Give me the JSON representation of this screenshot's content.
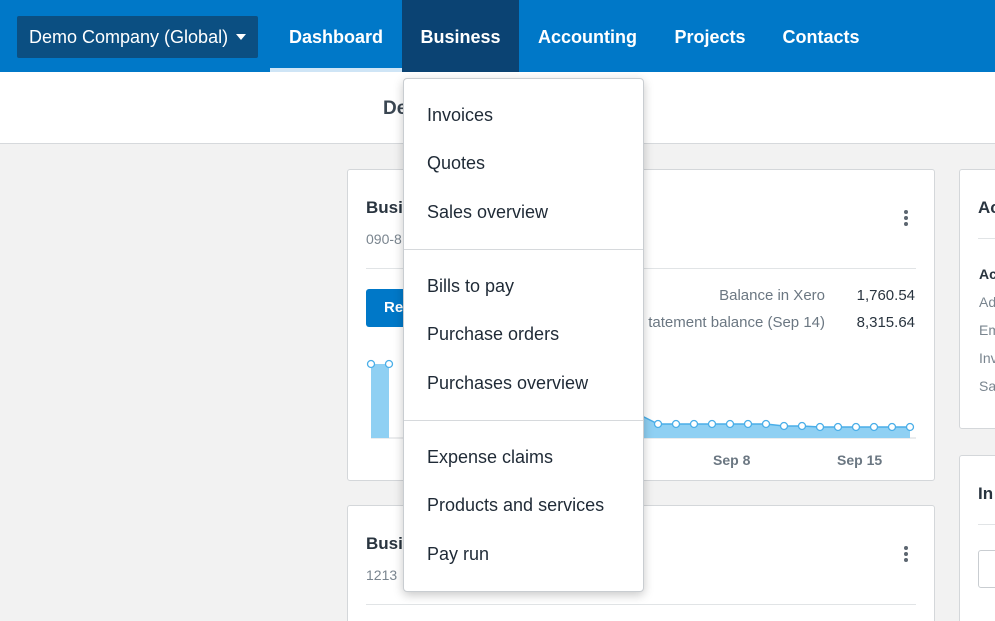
{
  "nav": {
    "org_name": "Demo Company (Global)",
    "items": [
      {
        "label": "Dashboard"
      },
      {
        "label": "Business"
      },
      {
        "label": "Accounting"
      },
      {
        "label": "Projects"
      },
      {
        "label": "Contacts"
      }
    ]
  },
  "page": {
    "title": "De"
  },
  "bank_card_1": {
    "title": "Busi",
    "account_number": "090-8",
    "reconcile_label": "Re",
    "balance_in_xero_label": "Balance in Xero",
    "balance_in_xero_value": "1,760.54",
    "statement_balance_label": "tatement balance (Sep 14)",
    "statement_balance_value": "8,315.64",
    "axis_labels": [
      "Sep 8",
      "Sep 15"
    ]
  },
  "bank_card_2": {
    "title": "Busi",
    "account_number": "1213"
  },
  "right_card_1": {
    "title": "Ac",
    "section_heading": "Ac",
    "rows": [
      "Ad",
      "Em",
      "Inv",
      "Sa"
    ]
  },
  "right_card_2": {
    "title": "In"
  },
  "business_menu": {
    "groups": [
      {
        "items": [
          "Invoices",
          "Quotes",
          "Sales overview"
        ]
      },
      {
        "items": [
          "Bills to pay",
          "Purchase orders",
          "Purchases overview"
        ]
      },
      {
        "items": [
          "Expense claims",
          "Products and services",
          "Pay run"
        ]
      }
    ]
  },
  "colors": {
    "nav_bg": "#0078c8",
    "nav_active": "#0b4373",
    "chart_fill": "#8fd0f3",
    "chart_line": "#4aaee8"
  }
}
